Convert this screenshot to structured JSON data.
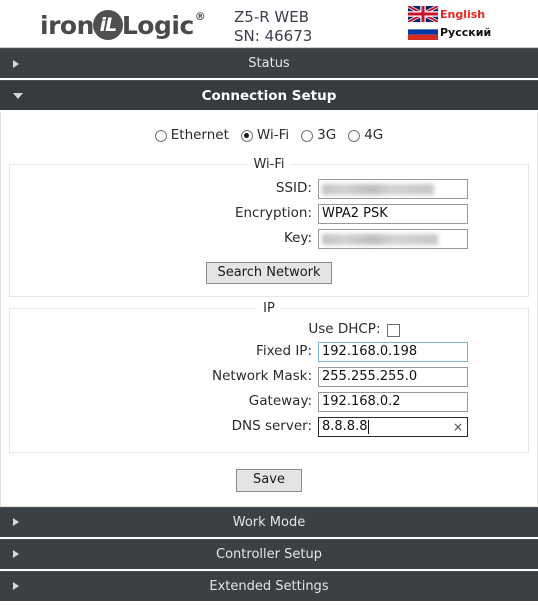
{
  "header": {
    "logo": {
      "left_text": "iron",
      "badge_text": "iL",
      "right_text": "Logic",
      "reg_mark": "®"
    },
    "device_title": "Z5-R WEB\nSN: 46673",
    "languages": [
      {
        "label": "English",
        "flag": "uk-flag-icon",
        "active": true
      },
      {
        "label": "Русский",
        "flag": "russia-flag-icon",
        "active": false
      }
    ]
  },
  "sections": [
    {
      "label": "Status",
      "expanded": false
    },
    {
      "label": "Connection Setup",
      "expanded": true
    },
    {
      "label": "Work Mode",
      "expanded": false
    },
    {
      "label": "Controller Setup",
      "expanded": false
    },
    {
      "label": "Extended Settings",
      "expanded": false
    }
  ],
  "connection": {
    "modes": [
      {
        "label": "Ethernet",
        "selected": false
      },
      {
        "label": "Wi-Fi",
        "selected": true
      },
      {
        "label": "3G",
        "selected": false
      },
      {
        "label": "4G",
        "selected": false
      }
    ],
    "wifi": {
      "legend": "Wi-Fi",
      "ssid_label": "SSID:",
      "ssid_value": "",
      "ssid_redacted": true,
      "encryption_label": "Encryption:",
      "encryption_value": "WPA2 PSK",
      "key_label": "Key:",
      "key_value": "",
      "key_redacted": true,
      "search_button": "Search Network"
    },
    "ip": {
      "legend": "IP",
      "dhcp_label": "Use DHCP:",
      "dhcp_checked": false,
      "fixed_ip_label": "Fixed IP:",
      "fixed_ip_value": "192.168.0.198",
      "mask_label": "Network Mask:",
      "mask_value": "255.255.255.0",
      "gateway_label": "Gateway:",
      "gateway_value": "192.168.0.2",
      "dns_label": "DNS server:",
      "dns_value": "8.8.8.8",
      "dns_clear_icon": "×"
    },
    "save_button": "Save"
  },
  "colors": {
    "header_bar": "#3a4044",
    "accent_red": "#e8261c",
    "focus_border": "#2b2b2b",
    "valid_border": "#7fb3d5"
  }
}
